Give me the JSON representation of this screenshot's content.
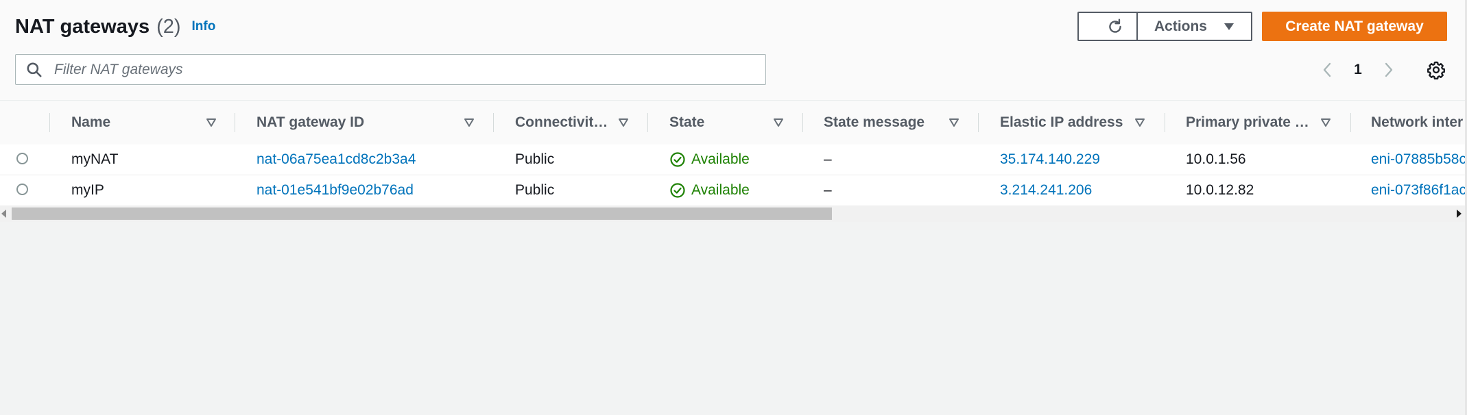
{
  "header": {
    "title": "NAT gateways",
    "count": "(2)",
    "info_label": "Info"
  },
  "toolbar": {
    "refresh_icon": "refresh-icon",
    "actions_label": "Actions",
    "create_label": "Create NAT gateway"
  },
  "search": {
    "placeholder": "Filter NAT gateways"
  },
  "pagination": {
    "current_page": "1"
  },
  "table": {
    "columns": [
      "Name",
      "NAT gateway ID",
      "Connectivit…",
      "State",
      "State message",
      "Elastic IP address",
      "Primary private …",
      "Network inter"
    ],
    "rows": [
      {
        "name": "myNAT",
        "id": "nat-06a75ea1cd8c2b3a4",
        "connectivity": "Public",
        "state": "Available",
        "state_message": "–",
        "elastic_ip": "35.174.140.229",
        "private_ip": "10.0.1.56",
        "network_interface": "eni-07885b58c"
      },
      {
        "name": "myIP",
        "id": "nat-01e541bf9e02b76ad",
        "connectivity": "Public",
        "state": "Available",
        "state_message": "–",
        "elastic_ip": "3.214.241.206",
        "private_ip": "10.0.12.82",
        "network_interface": "eni-073f86f1ac"
      }
    ]
  },
  "colors": {
    "primary_button": "#ec7211",
    "link": "#0073bb",
    "success": "#1d8102",
    "background": "#f2f3f3"
  }
}
